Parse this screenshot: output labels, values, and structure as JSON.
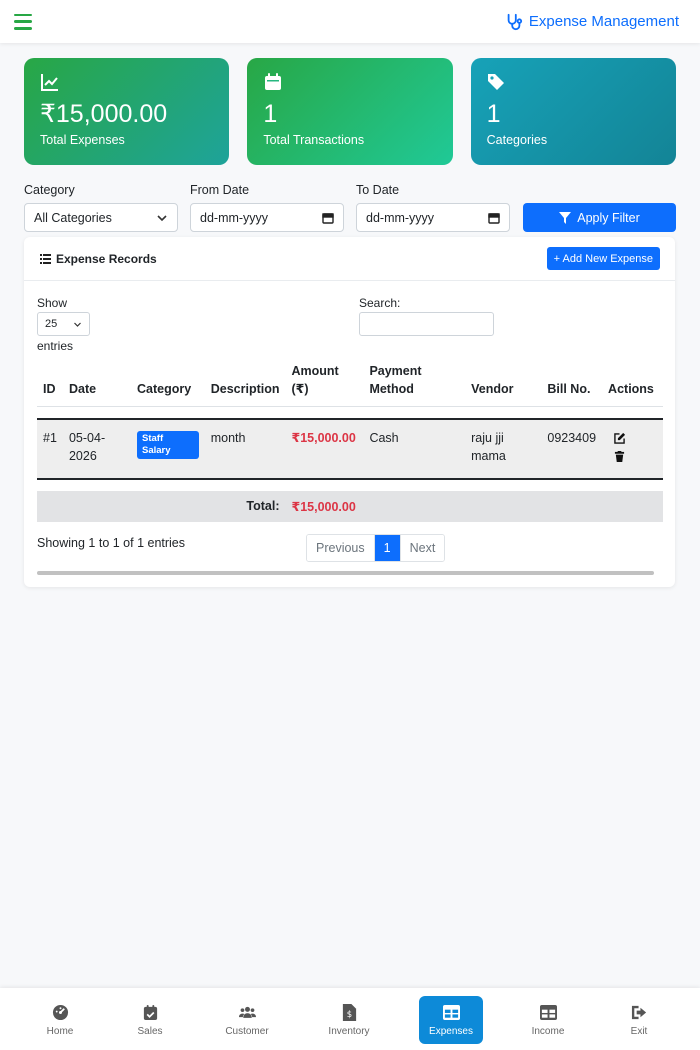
{
  "header": {
    "title": "Expense Management"
  },
  "stats": [
    {
      "value": "₹15,000.00",
      "label": "Total Expenses",
      "icon": "chart-line-icon"
    },
    {
      "value": "1",
      "label": "Total Transactions",
      "icon": "calendar-icon"
    },
    {
      "value": "1",
      "label": "Categories",
      "icon": "tags-icon"
    }
  ],
  "filters": {
    "category_label": "Category",
    "category_value": "All Categories",
    "from_label": "From Date",
    "from_value": "dd-mm-yyyy",
    "to_label": "To Date",
    "to_value": "dd-mm-yyyy",
    "apply_label": "Apply Filter"
  },
  "records": {
    "title": "Expense Records",
    "add_label": "+ Add New Expense",
    "show_label": "Show",
    "show_value": "25",
    "entries_label": "entries",
    "search_label": "Search:",
    "columns": [
      "ID",
      "Date",
      "Category",
      "Description",
      "Amount (₹)",
      "Payment Method",
      "Vendor",
      "Bill No.",
      "Actions"
    ],
    "rows": [
      {
        "id": "#1",
        "date": "05-04-2026",
        "category": "Staff Salary",
        "description": "month",
        "amount": "₹15,000.00",
        "payment": "Cash",
        "vendor": "raju jji mama",
        "bill": "0923409"
      }
    ],
    "total_label": "Total:",
    "total_value": "₹15,000.00",
    "showing_text": "Showing 1 to 1 of 1 entries",
    "pagination": {
      "prev": "Previous",
      "current": "1",
      "next": "Next"
    }
  },
  "nav": [
    {
      "label": "Home",
      "icon": "dashboard-icon"
    },
    {
      "label": "Sales",
      "icon": "calendar-check-icon"
    },
    {
      "label": "Customer",
      "icon": "users-icon"
    },
    {
      "label": "Inventory",
      "icon": "file-invoice-icon"
    },
    {
      "label": "Expenses",
      "icon": "table-icon",
      "active": true
    },
    {
      "label": "Income",
      "icon": "table-icon"
    },
    {
      "label": "Exit",
      "icon": "sign-out-icon"
    }
  ],
  "colors": {
    "primary": "#0d6efd",
    "success": "#28a745",
    "danger": "#dc3545",
    "active_nav": "#0d8ad8"
  }
}
